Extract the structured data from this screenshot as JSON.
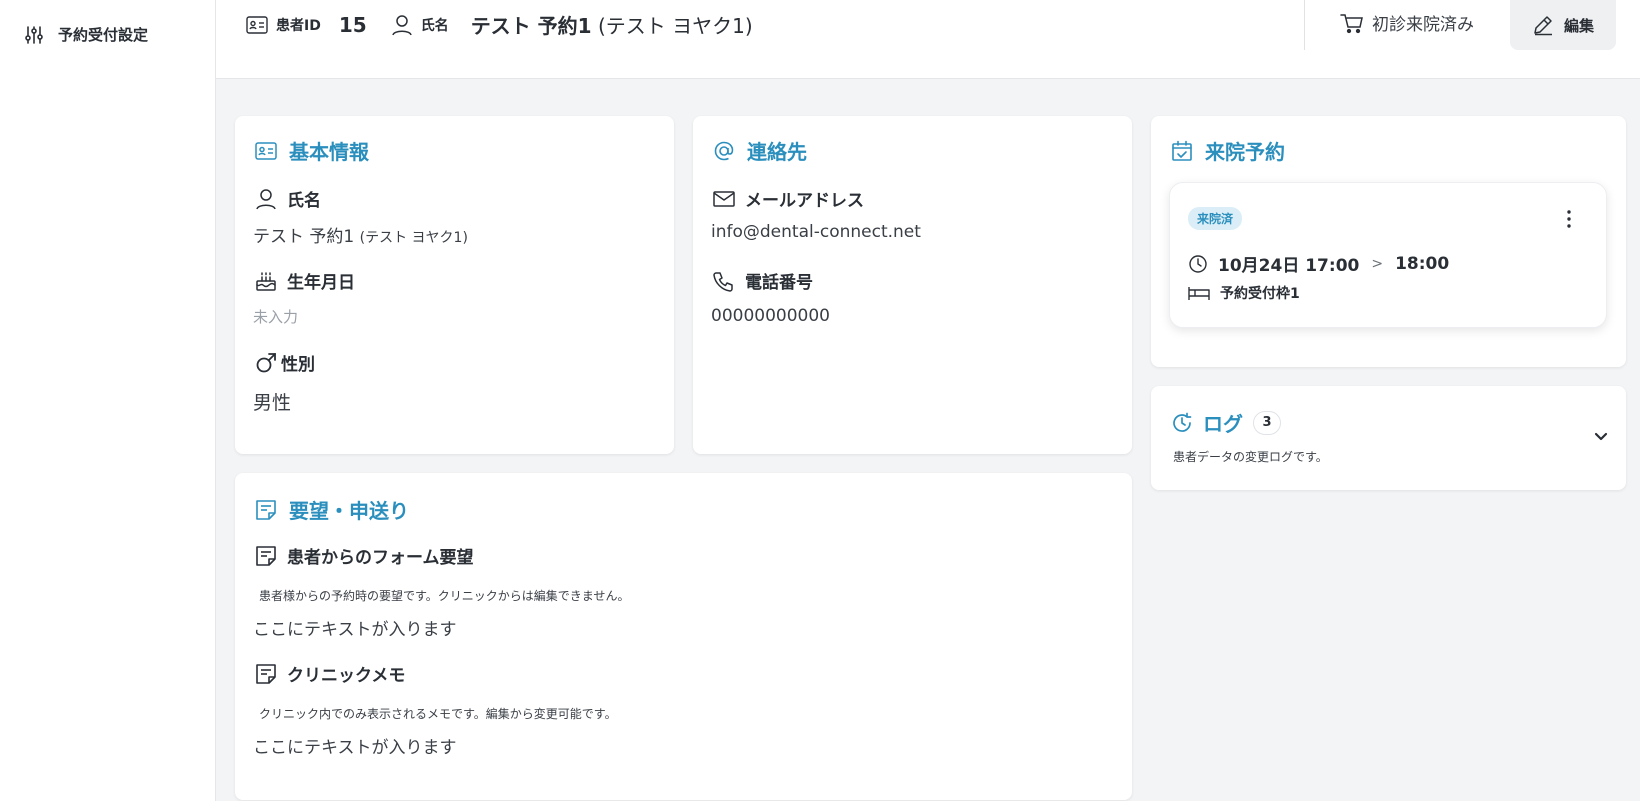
{
  "sidebar": {
    "items": [
      {
        "label": "予約受付設定",
        "icon": "sliders-icon"
      }
    ]
  },
  "header": {
    "patient_id_label": "患者ID",
    "patient_id": "15",
    "name_label": "氏名",
    "name_main": "テスト 予約1",
    "name_kana": "(テスト ヨヤク1)",
    "first_visit_label": "初診来院済み",
    "edit_label": "編集"
  },
  "basic_info": {
    "title": "基本情報",
    "name_label": "氏名",
    "name_main": "テスト 予約1",
    "name_kana": "(テスト ヨヤク1)",
    "birthday_label": "生年月日",
    "birthday_value": "未入力",
    "gender_label": "性別",
    "gender_value": "男性"
  },
  "contact": {
    "title": "連絡先",
    "email_label": "メールアドレス",
    "email_value": "info@dental-connect.net",
    "phone_label": "電話番号",
    "phone_value": "00000000000"
  },
  "appointment": {
    "title": "来院予約",
    "status_badge": "来院済",
    "date_start": "10月24日 17:00",
    "separator": ">",
    "time_end": "18:00",
    "slot_name": "予約受付枠1"
  },
  "log": {
    "title": "ログ",
    "count": "3",
    "description": "患者データの変更ログです。"
  },
  "requests": {
    "title": "要望・申送り",
    "form_title": "患者からのフォーム要望",
    "form_desc": "患者様からの予約時の要望です。クリニックからは編集できません。",
    "form_text": "ここにテキストが入ります",
    "memo_title": "クリニックメモ",
    "memo_desc": "クリニック内でのみ表示されるメモです。編集から変更可能です。",
    "memo_text": "ここにテキストが入ります"
  },
  "colors": {
    "accent": "#2b8fbe",
    "badge_bg": "#dbeef7",
    "page_bg": "#f3f4f6"
  }
}
